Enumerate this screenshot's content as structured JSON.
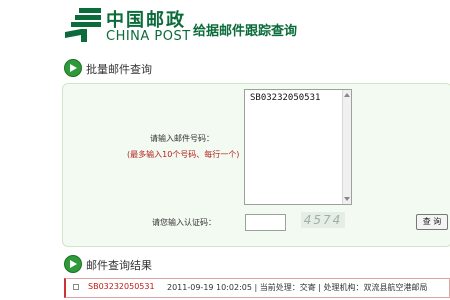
{
  "header": {
    "brand_cn": "中国邮政",
    "brand_en": "CHINA POST",
    "title": "给据邮件跟踪查询",
    "brand_color": "#0b6b3a"
  },
  "batch_section": {
    "title": "批量邮件查询",
    "number_label": "请输入邮件号码：",
    "number_note": "(最多输入10个号码、每行一个)",
    "tracking_input_value": "SB03232050531",
    "captcha_label": "请您输入认证码：",
    "captcha_input_value": "",
    "captcha_image_text": "4574",
    "query_button": "查 询"
  },
  "results_section": {
    "title": "邮件查询结果",
    "rows": [
      {
        "number": "SB03232050531",
        "details": "2011-09-19 10:02:05 | 当前处理：交寄 | 处理机构：双流县航空港邮局"
      }
    ]
  }
}
